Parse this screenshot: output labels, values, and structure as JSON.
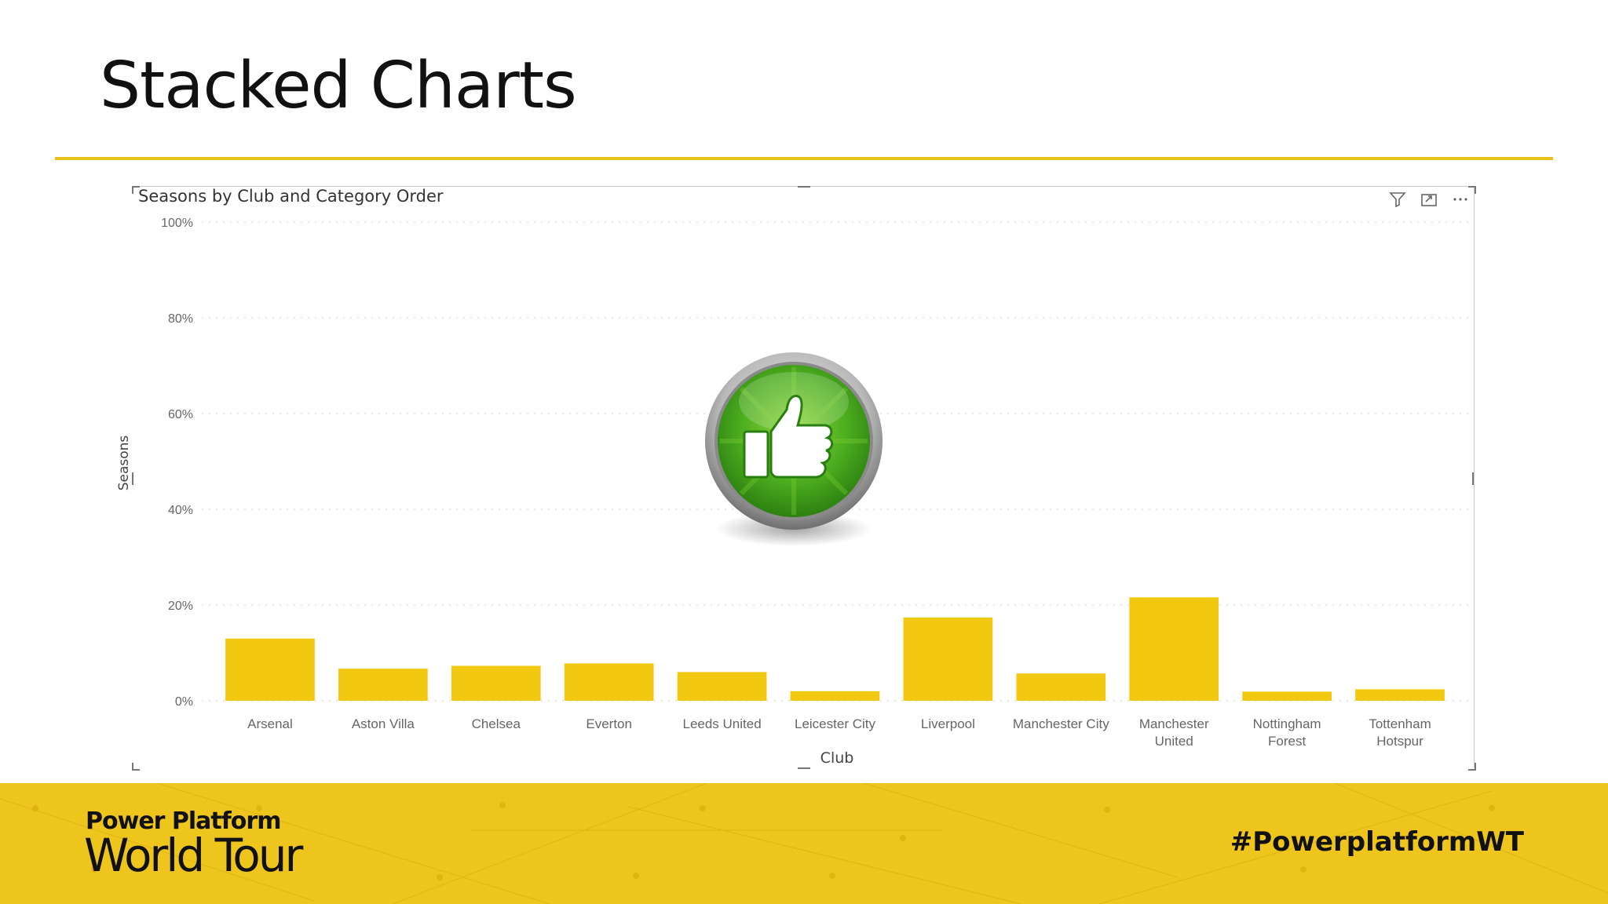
{
  "slide": {
    "title": "Stacked Charts"
  },
  "visual": {
    "title": "Seasons by Club and Category Order",
    "icons": [
      "filter-icon",
      "focus-mode-icon",
      "more-options-icon"
    ]
  },
  "colors": {
    "accent": "#eec51d",
    "bar": "#f2c811",
    "badge_green": "#3d9a1a"
  },
  "chart_data": {
    "type": "bar",
    "title": "Seasons by Club and Category Order",
    "xlabel": "Club",
    "ylabel": "Seasons",
    "ylim": [
      0,
      100
    ],
    "y_ticks": [
      "0%",
      "20%",
      "40%",
      "60%",
      "80%",
      "100%"
    ],
    "grid": true,
    "categories": [
      [
        "Arsenal"
      ],
      [
        "Aston Villa"
      ],
      [
        "Chelsea"
      ],
      [
        "Everton"
      ],
      [
        "Leeds United"
      ],
      [
        "Leicester City"
      ],
      [
        "Liverpool"
      ],
      [
        "Manchester City"
      ],
      [
        "Manchester",
        "United"
      ],
      [
        "Nottingham",
        "Forest"
      ],
      [
        "Tottenham",
        "Hotspur"
      ]
    ],
    "values": [
      13.0,
      6.7,
      7.3,
      7.8,
      6.0,
      2.0,
      17.4,
      5.7,
      21.6,
      1.9,
      2.4
    ]
  },
  "footer": {
    "brand_line1": "Power Platform",
    "brand_line2": "World Tour",
    "hashtag": "#PowerplatformWT"
  }
}
